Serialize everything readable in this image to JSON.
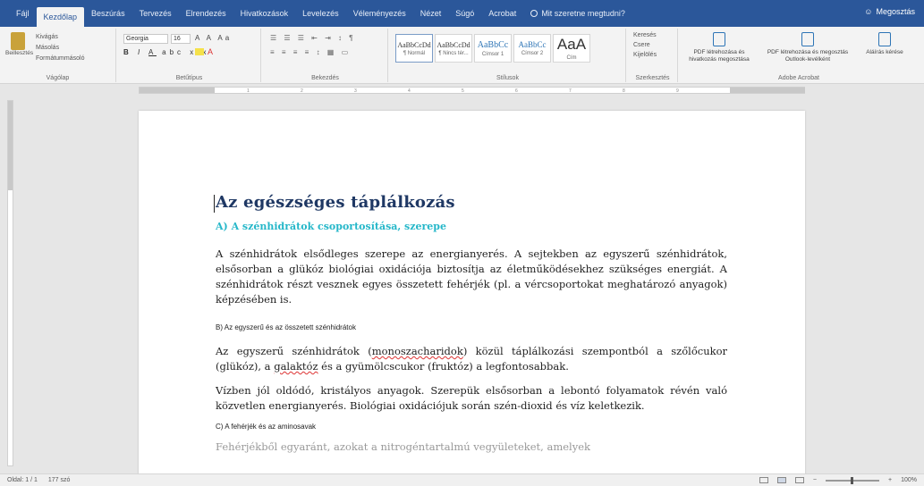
{
  "tabs": [
    "Fájl",
    "Kezdőlap",
    "Beszúrás",
    "Tervezés",
    "Elrendezés",
    "Hivatkozások",
    "Levelezés",
    "Véleményezés",
    "Nézet",
    "Súgó",
    "Acrobat"
  ],
  "active_tab_index": 1,
  "tell_me": "Mit szeretne megtudni?",
  "share": "Megosztás",
  "ribbon": {
    "clipboard": {
      "paste": "Beillesztés",
      "cut": "Kivágás",
      "copy": "Másolás",
      "format_painter": "Formátummásoló",
      "label": "Vágólap"
    },
    "font": {
      "name": "Georgia",
      "size": "16",
      "label": "Betűtípus"
    },
    "paragraph": {
      "label": "Bekezdés"
    },
    "styles": {
      "items": [
        {
          "sample": "AaBbCcDd",
          "name": "¶ Normál"
        },
        {
          "sample": "AaBbCcDd",
          "name": "¶ Nincs tér..."
        },
        {
          "sample": "AaBbCc",
          "name": "Címsor 1"
        },
        {
          "sample": "AaBbCc",
          "name": "Címsor 2"
        },
        {
          "sample": "AaA",
          "name": "Cím"
        }
      ],
      "label": "Stílusok"
    },
    "editing": {
      "find": "Keresés",
      "replace": "Csere",
      "select": "Kijelölés",
      "label": "Szerkesztés"
    },
    "acrobat": {
      "btn1": "PDF létrehozása és hivatkozás megosztása",
      "btn2": "PDF létrehozása és megosztás Outlook-levélként",
      "btn3": "Aláírás kérése",
      "label": "Adobe Acrobat"
    }
  },
  "document": {
    "title": "Az egészséges táplálkozás",
    "subtitle": "A) A szénhidrátok csoportosítása, szerepe",
    "p1": "A szénhidrátok elsődleges szerepe az energianyerés. A sejtekben az egyszerű szénhidrátok, elsősorban a glükóz biológiai oxidációja biztosítja az életműködésekhez szükséges energiát. A szénhidrátok részt vesznek egyes összetett fehérjék (pl. a vércsoportokat meghatározó anyagok) képzésében is.",
    "h3a": "B) Az egyszerű és az összetett szénhidrátok",
    "p2_start": "Az egyszerű szénhidrátok (",
    "p2_mono": "monoszacharidok",
    "p2_mid": ") közül táplálkozási szempontból a szőlőcukor (glükóz), a ",
    "p2_gal": "galaktóz",
    "p2_end": " és a gyümölcscukor (fruktóz) a legfontosabbak.",
    "p3": "Vízben jól oldódó, kristályos anyagok. Szerepük elsősorban a lebontó folyamatok révén való közvetlen energianyerés. Biológiai oxidációjuk során szén-dioxid és víz keletkezik.",
    "h3b": "C) A fehérjék és az aminosavak",
    "p4": "Fehérjékből egyaránt, azokat a nitrogéntartalmú vegyületeket, amelyek"
  },
  "status": {
    "page": "Oldal: 1 / 1",
    "words": "177 szó",
    "zoom": "100%"
  }
}
